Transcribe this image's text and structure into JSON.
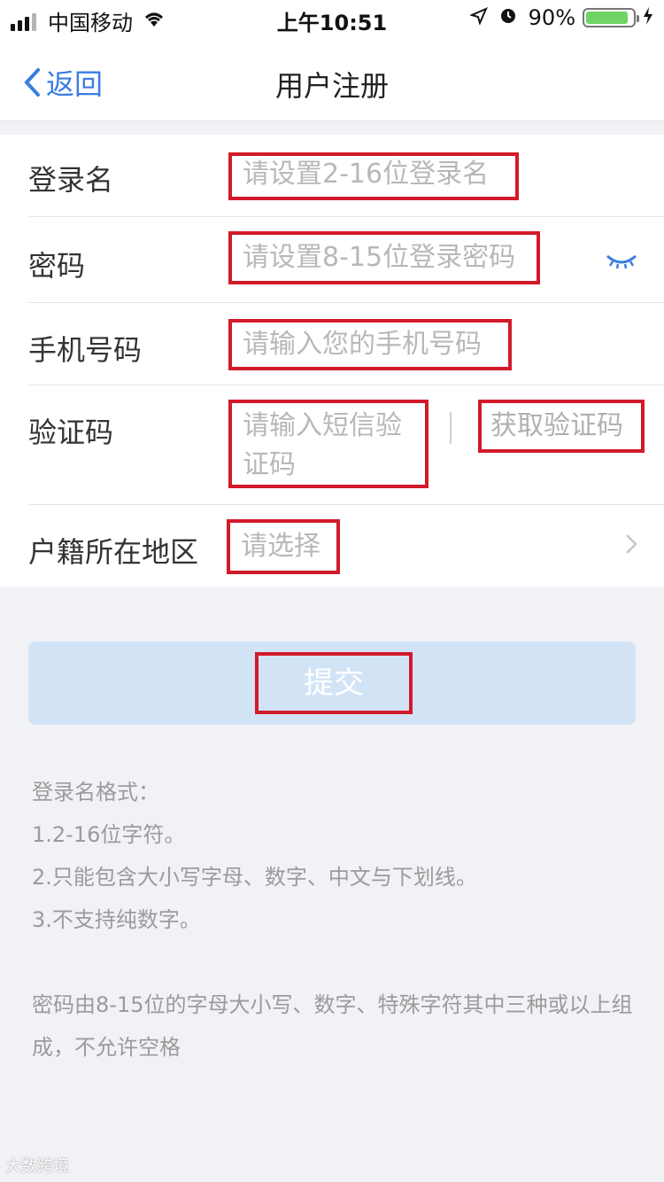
{
  "status_bar": {
    "carrier": "中国移动",
    "time": "上午10:51",
    "battery": "90%",
    "battery_level": 0.9
  },
  "nav": {
    "back_label": "返回",
    "title": "用户注册"
  },
  "form": {
    "login_name": {
      "label": "登录名",
      "placeholder": "请设置2-16位登录名"
    },
    "password": {
      "label": "密码",
      "placeholder": "请设置8-15位登录密码"
    },
    "phone": {
      "label": "手机号码",
      "placeholder": "请输入您的手机号码"
    },
    "code": {
      "label": "验证码",
      "placeholder": "请输入短信验证码",
      "get_code_label": "获取验证码"
    },
    "region": {
      "label": "户籍所在地区",
      "placeholder": "请选择"
    }
  },
  "submit_label": "提交",
  "notes": {
    "login_title": "登录名格式：",
    "login_rules": [
      "1.2-16位字符。",
      "2.只能包含大小写字母、数字、中文与下划线。",
      "3.不支持纯数字。"
    ],
    "password_rule": "密码由8-15位的字母大小写、数字、特殊字符其中三种或以上组成，不允许空格"
  },
  "watermark": "大数跨境",
  "colors": {
    "accent": "#3b7de0",
    "highlight_border": "#d21a2a",
    "submit_bg": "#d3e3f6",
    "page_bg": "#f0f2f6"
  }
}
